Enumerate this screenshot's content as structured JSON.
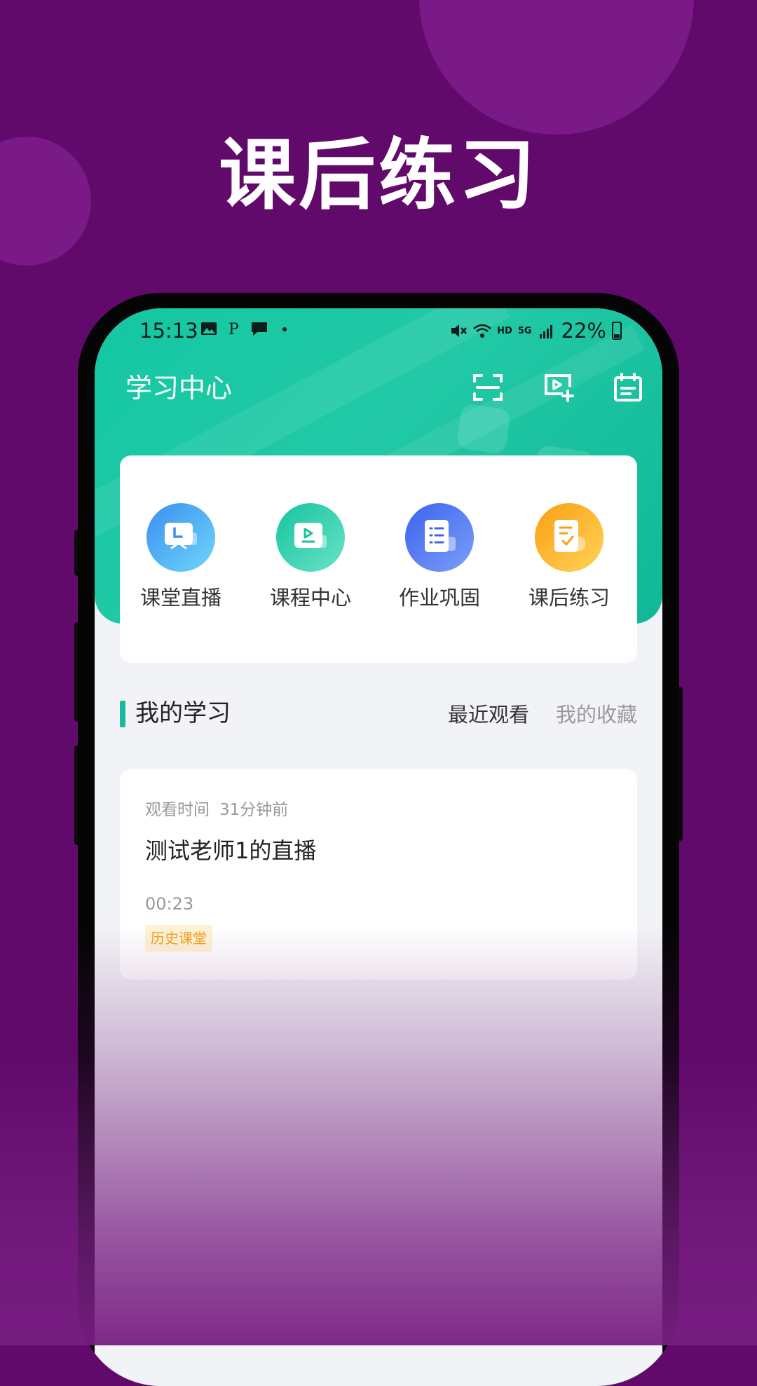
{
  "promo": {
    "title": "课后练习"
  },
  "status_bar": {
    "time": "15:13",
    "network_hd": "HD",
    "network_gen": "5G",
    "battery": "22%"
  },
  "app_bar": {
    "title": "学习中心",
    "icons": [
      "scan-icon",
      "video-add-icon",
      "calendar-icon"
    ]
  },
  "quick_actions": [
    {
      "label": "课堂直播",
      "icon": "live-classroom-icon",
      "color_from": "#3ba0f5",
      "color_to": "#6fd0f8"
    },
    {
      "label": "课程中心",
      "icon": "course-center-icon",
      "color_from": "#1dc9a3",
      "color_to": "#63e0c4"
    },
    {
      "label": "作业巩固",
      "icon": "homework-icon",
      "color_from": "#3f6cf0",
      "color_to": "#7a9bf6"
    },
    {
      "label": "课后练习",
      "icon": "practice-icon",
      "color_from": "#fba51a",
      "color_to": "#ffc94a"
    }
  ],
  "section": {
    "title": "我的学习",
    "tab_recent": "最近观看",
    "tab_favorites": "我的收藏"
  },
  "history": {
    "meta_label": "观看时间",
    "meta_time": "31分钟前",
    "title": "测试老师1的直播",
    "duration": "00:23",
    "tag": "历史课堂"
  },
  "colors": {
    "background": "#620a6c",
    "accent": "#1ab99b",
    "tag_text": "#f5a623"
  }
}
